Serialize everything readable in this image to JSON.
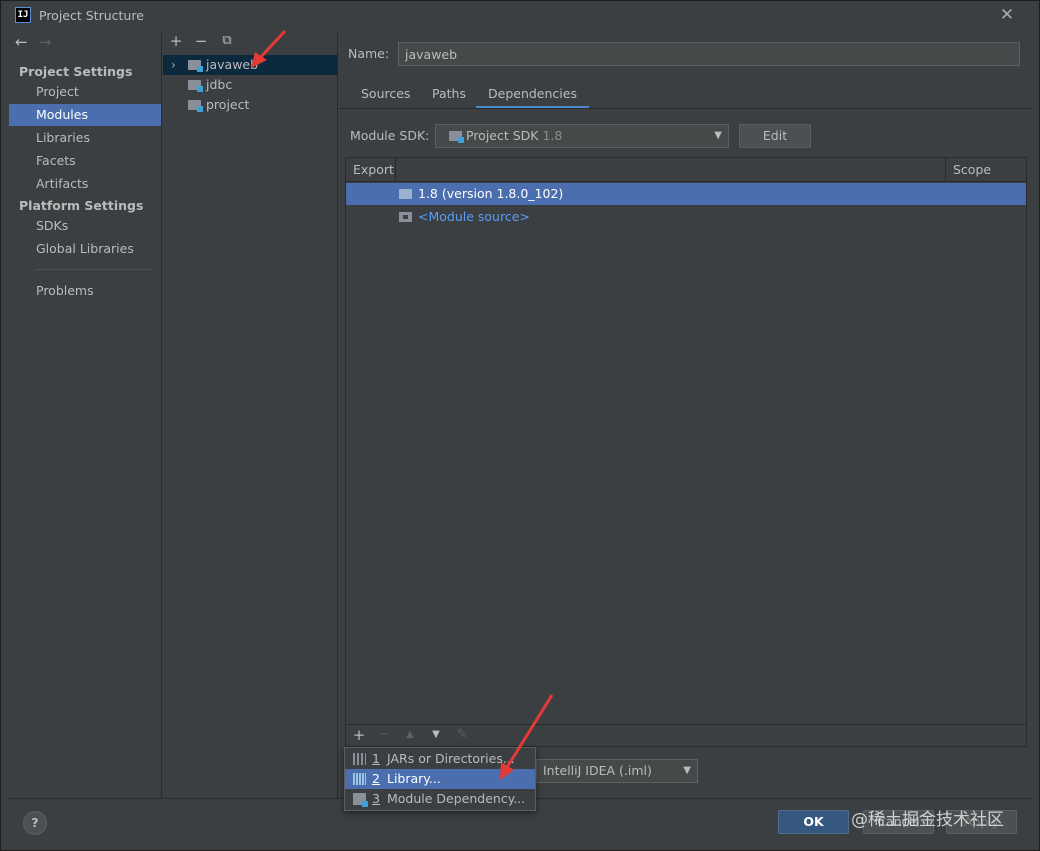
{
  "window": {
    "title": "Project Structure",
    "app_icon_text": "IJ"
  },
  "nav": {
    "project_settings_header": "Project Settings",
    "platform_settings_header": "Platform Settings",
    "items": {
      "project": "Project",
      "modules": "Modules",
      "libraries": "Libraries",
      "facets": "Facets",
      "artifacts": "Artifacts",
      "sdks": "SDKs",
      "global_libraries": "Global Libraries",
      "problems": "Problems"
    },
    "selected": "Modules"
  },
  "module_tree": {
    "toolbar": {
      "add": "+",
      "remove": "−",
      "copy": "⧉"
    },
    "modules": [
      "javaweb",
      "jdbc",
      "project"
    ],
    "selected": "javaweb"
  },
  "module_details": {
    "name_label": "Name:",
    "name_value": "javaweb",
    "tabs": [
      "Sources",
      "Paths",
      "Dependencies"
    ],
    "active_tab": "Dependencies",
    "sdk_label": "Module SDK:",
    "sdk_name": "Project SDK",
    "sdk_version": "1.8",
    "edit_button": "Edit",
    "table": {
      "columns": {
        "export": "Export",
        "scope": "Scope"
      },
      "rows": [
        {
          "text": "1.8 (version 1.8.0_102)",
          "selected": true
        },
        {
          "text": "<Module source>",
          "selected": false
        }
      ]
    },
    "format_value": "IntelliJ IDEA (.iml)"
  },
  "add_menu": {
    "items": [
      {
        "number": "1",
        "label": "JARs or Directories..."
      },
      {
        "number": "2",
        "label": "Library..."
      },
      {
        "number": "3",
        "label": "Module Dependency..."
      }
    ],
    "selected_index": 1
  },
  "footer": {
    "help": "?",
    "ok": "OK",
    "cancel": "Cancel",
    "apply": "Apply"
  },
  "watermark": "@稀土掘金技术社区",
  "colors": {
    "background": "#3c3f41",
    "selection": "#4b6eaf",
    "link": "#589df6",
    "ok_button": "#365880",
    "annotation": "#e53935"
  }
}
